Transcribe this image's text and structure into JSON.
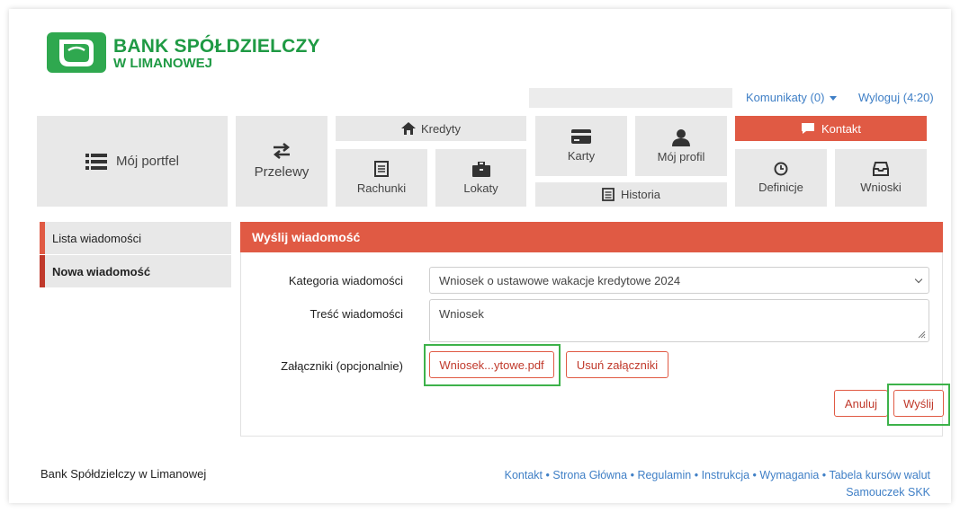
{
  "brand": {
    "name_line1": "BANK SPÓŁDZIELCZY",
    "name_line2": "W LIMANOWEJ",
    "color": "#1f9a44"
  },
  "topbar": {
    "komunikaty": "Komunikaty (0)",
    "wyloguj": "Wyloguj (4:20)"
  },
  "menu": {
    "moj_portfel": "Mój portfel",
    "przelewy": "Przelewy",
    "kredyty": "Kredyty",
    "rachunki": "Rachunki",
    "lokaty": "Lokaty",
    "karty": "Karty",
    "moj_profil": "Mój profil",
    "historia": "Historia",
    "kontakt": "Kontakt",
    "definicje": "Definicje",
    "wnioski": "Wnioski"
  },
  "sidebar": {
    "items": [
      {
        "label": "Lista wiadomości"
      },
      {
        "label": "Nowa wiadomość"
      }
    ]
  },
  "panel": {
    "title": "Wyślij wiadomość",
    "category_label": "Kategoria wiadomości",
    "category_value": "Wniosek o ustawowe wakacje kredytowe 2024",
    "content_label": "Treść wiadomości",
    "content_value": "Wniosek",
    "attachments_label": "Załączniki (opcjonalnie)",
    "attachment_file": "Wniosek...ytowe.pdf",
    "remove_attachments": "Usuń załączniki",
    "cancel": "Anuluj",
    "send": "Wyślij"
  },
  "footer": {
    "bank_name": "Bank Spółdzielczy w Limanowej",
    "links": [
      "Kontakt",
      "Strona Główna",
      "Regulamin",
      "Instrukcja",
      "Wymagania",
      "Tabela kursów walut"
    ],
    "link_line2": "Samouczek SKK"
  },
  "colors": {
    "accent": "#e05a44",
    "accent_dark": "#c0392b",
    "link": "#3f7fc6",
    "highlight": "#3db24a",
    "tile": "#e8e8e8"
  }
}
